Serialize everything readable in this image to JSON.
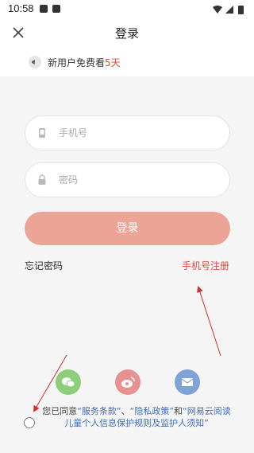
{
  "status": {
    "time": "10:58"
  },
  "header": {
    "title": "登录",
    "close_icon": "close-icon"
  },
  "promo": {
    "prefix": "新用户免费看",
    "days": "5天",
    "icon": "megaphone-icon"
  },
  "form": {
    "phone_placeholder": "手机号",
    "password_placeholder": "密码",
    "login_label": "登录"
  },
  "links": {
    "forgot": "忘记密码",
    "register": "手机号注册"
  },
  "social": [
    {
      "name": "wechat",
      "icon": "wechat-icon",
      "color": "#8cce7a"
    },
    {
      "name": "weibo",
      "icon": "weibo-icon",
      "color": "#e69292"
    },
    {
      "name": "mail",
      "icon": "mail-icon",
      "color": "#7fa3d6"
    }
  ],
  "agreement": {
    "prefix": "您已同意",
    "terms": "“服务条款”",
    "separator": "、",
    "privacy": "“隐私政策”",
    "and": "和",
    "children": "“网易云阅读儿童个人信息保护规则及监护人须知”"
  },
  "colors": {
    "accent": "#e04a3a",
    "button": "#eba496",
    "link": "#3a6fc4"
  }
}
